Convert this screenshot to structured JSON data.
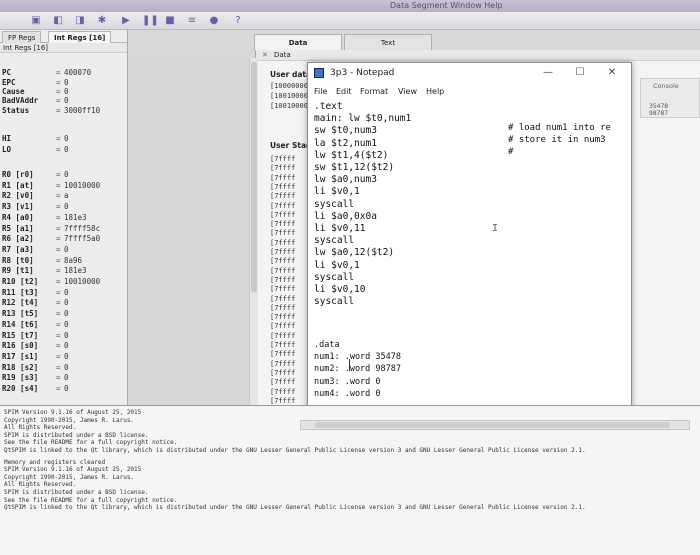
{
  "app": {
    "window_title": "Data Segment    Window    Help"
  },
  "registers": {
    "tabs": [
      "FP Regs",
      "Int Regs [16]"
    ],
    "header": "Int Regs [16]",
    "special": [
      {
        "name": "PC",
        "value": "400070"
      },
      {
        "name": "EPC",
        "value": "0"
      },
      {
        "name": "Cause",
        "value": "0"
      },
      {
        "name": "BadVAddr",
        "value": "0"
      },
      {
        "name": "Status",
        "value": "3000ff10"
      },
      {
        "name": "HI",
        "value": "0"
      },
      {
        "name": "LO",
        "value": "0"
      }
    ],
    "general": [
      {
        "name": "R0  [r0]",
        "value": "0"
      },
      {
        "name": "R1  [at]",
        "value": "10010000"
      },
      {
        "name": "R2  [v0]",
        "value": "a"
      },
      {
        "name": "R3  [v1]",
        "value": "0"
      },
      {
        "name": "R4  [a0]",
        "value": "181e3"
      },
      {
        "name": "R5  [a1]",
        "value": "7ffff58c"
      },
      {
        "name": "R6  [a2]",
        "value": "7ffff5a0"
      },
      {
        "name": "R7  [a3]",
        "value": "0"
      },
      {
        "name": "R8  [t0]",
        "value": "8a96"
      },
      {
        "name": "R9  [t1]",
        "value": "181e3"
      },
      {
        "name": "R10 [t2]",
        "value": "10010000"
      },
      {
        "name": "R11 [t3]",
        "value": "0"
      },
      {
        "name": "R12 [t4]",
        "value": "0"
      },
      {
        "name": "R13 [t5]",
        "value": "0"
      },
      {
        "name": "R14 [t6]",
        "value": "0"
      },
      {
        "name": "R15 [t7]",
        "value": "0"
      },
      {
        "name": "R16 [s0]",
        "value": "0"
      },
      {
        "name": "R17 [s1]",
        "value": "0"
      },
      {
        "name": "R18 [s2]",
        "value": "0"
      },
      {
        "name": "R19 [s3]",
        "value": "0"
      },
      {
        "name": "R20 [s4]",
        "value": "0"
      }
    ]
  },
  "memory": {
    "tabs": [
      "Data",
      "Text"
    ],
    "header": "Data",
    "user_data_title": "User data",
    "user_data_addrs": [
      "[10000000]",
      "[10010000]",
      "[10010000]"
    ],
    "user_stack_title": "User Stack",
    "stack_addr": "[7ffff"
  },
  "side": {
    "button": "Console",
    "values": [
      "35478",
      "98787"
    ]
  },
  "notepad": {
    "title": "3p3 - Notepad",
    "menu": [
      "File",
      "Edit",
      "Format",
      "View",
      "Help"
    ],
    "code": [
      ".text",
      "main:   lw $t0,num1",
      "        sw $t0,num3",
      "        la $t2,num1",
      "        lw $t1,4($t2)",
      "        sw $t1,12($t2)",
      "        lw $a0,num3",
      "        li $v0,1",
      "        syscall",
      "        li $a0,0x0a",
      "        li $v0,11",
      "        syscall",
      "        lw $a0,12($t2)",
      "        li $v0,1",
      "        syscall",
      "        li $v0,10",
      "        syscall"
    ],
    "comments": [
      "# load num1 into re",
      "# store it in num3",
      "#"
    ],
    "data_section": [
      "        .data",
      "num1:   .word 35478",
      "num2:   .word 98787",
      "num3:   .word 0",
      "num4:   .word 0"
    ]
  },
  "console": {
    "lines": [
      "SPIM Version 9.1.16 of August 25, 2015",
      "Copyright 1990-2015, James R. Larus.",
      "All Rights Reserved.",
      "SPIM is distributed under a BSD license.",
      "See the file README for a full copyright notice.",
      "QtSPIM is linked to the Qt library, which is distributed under the GNU Lesser General Public License version 3 and GNU Lesser General Public License version 2.1.",
      "Memory and registers cleared",
      "SPIM Version 9.1.16 of August 25, 2015",
      "Copyright 1990-2015, James R. Larus.",
      "All Rights Reserved.",
      "SPIM is distributed under a BSD license.",
      "See the file README for a full copyright notice.",
      "QtSPIM is linked to the Qt library, which is distributed under the GNU Lesser General Public License version 3 and GNU Lesser General Public License version 2.1."
    ]
  }
}
